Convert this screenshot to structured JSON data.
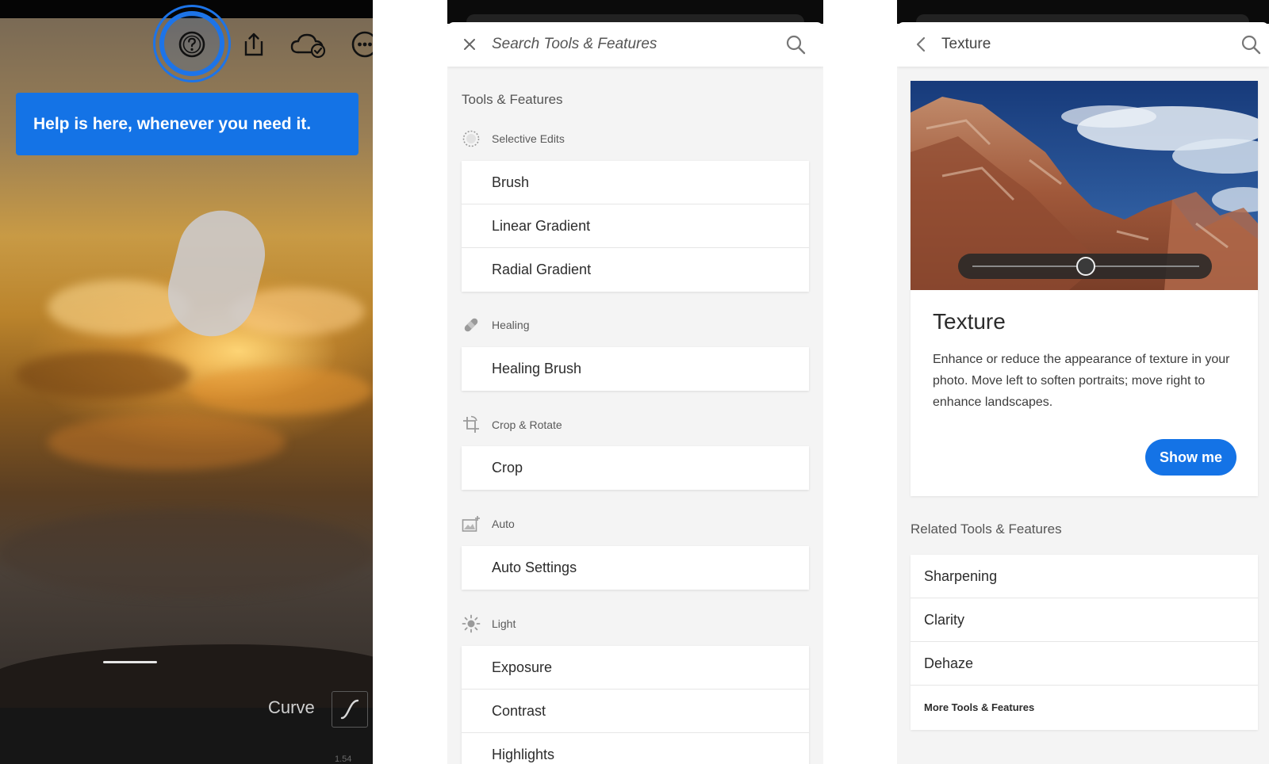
{
  "colors": {
    "accent_blue": "#1473e6",
    "ring_blue": "#1d74e8",
    "panel_bg": "#f4f4f4",
    "card_bg": "#ffffff",
    "editor_bg": "#161616"
  },
  "editor": {
    "toolbar_icons": [
      "help-icon",
      "share-icon",
      "cloud-synced-icon",
      "more-icon"
    ],
    "tooltip": "Help is here, whenever you need it.",
    "curve_label": "Curve",
    "curve_icon": "curve-icon",
    "bottom_partial": "1.54"
  },
  "search": {
    "placeholder": "Search Tools & Features",
    "section_title": "Tools & Features",
    "categories": [
      {
        "label": "Selective Edits",
        "icon": "selective-edits-icon",
        "items": [
          "Brush",
          "Linear Gradient",
          "Radial Gradient"
        ]
      },
      {
        "label": "Healing",
        "icon": "healing-bandage-icon",
        "items": [
          "Healing Brush"
        ]
      },
      {
        "label": "Crop & Rotate",
        "icon": "crop-rotate-icon",
        "items": [
          "Crop"
        ]
      },
      {
        "label": "Auto",
        "icon": "auto-image-icon",
        "items": [
          "Auto Settings"
        ]
      },
      {
        "label": "Light",
        "icon": "sun-icon",
        "items": [
          "Exposure",
          "Contrast",
          "Highlights"
        ]
      }
    ]
  },
  "detail": {
    "header_title": "Texture",
    "heading": "Texture",
    "description": "Enhance or reduce the appearance of texture in your photo. Move left to soften portraits; move right to enhance landscapes.",
    "slider_value_fraction": 0.5,
    "show_me_label": "Show me",
    "related_title": "Related Tools & Features",
    "related_items": [
      "Sharpening",
      "Clarity",
      "Dehaze"
    ],
    "more_label": "More Tools & Features"
  }
}
